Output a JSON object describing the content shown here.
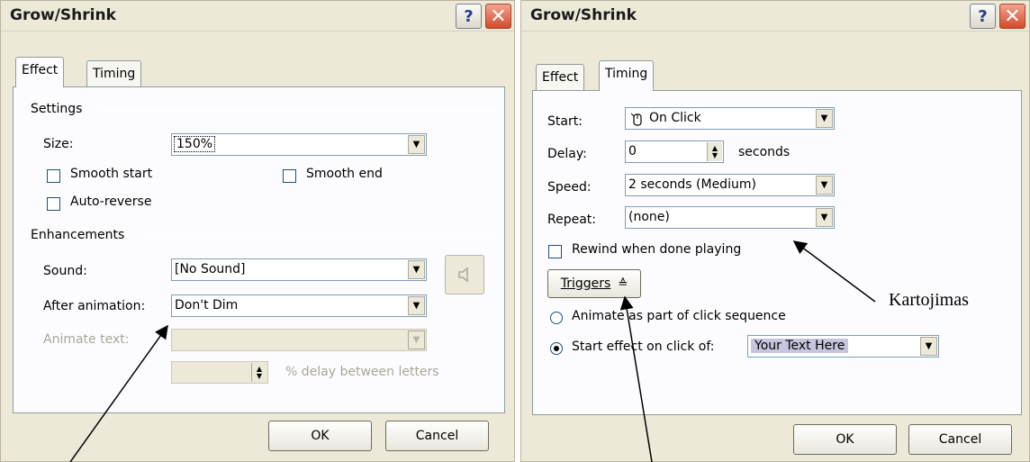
{
  "left_dialog": {
    "title": "Grow/Shrink",
    "help_label": "?",
    "close_label": "✕",
    "tabs": [
      {
        "label": "Effect",
        "active": true
      },
      {
        "label": "Timing",
        "active": false
      }
    ],
    "settings": {
      "group_label": "Settings",
      "size_label": "Size:",
      "size_value": "150%",
      "smooth_start_label": "Smooth start",
      "smooth_end_label": "Smooth end",
      "auto_reverse_label": "Auto-reverse"
    },
    "enhancements": {
      "group_label": "Enhancements",
      "sound_label": "Sound:",
      "sound_value": "[No Sound]",
      "after_animation_label": "After animation:",
      "after_animation_value": "Don't Dim",
      "animate_text_label": "Animate text:",
      "animate_text_value": "",
      "delay_value": "",
      "delay_suffix": "% delay between letters"
    },
    "ok_label": "OK",
    "cancel_label": "Cancel"
  },
  "right_dialog": {
    "title": "Grow/Shrink",
    "help_label": "?",
    "close_label": "✕",
    "tabs": [
      {
        "label": "Effect",
        "active": false
      },
      {
        "label": "Timing",
        "active": true
      }
    ],
    "start_label": "Start:",
    "start_value": "On Click",
    "delay_label": "Delay:",
    "delay_value": "0",
    "delay_unit": "seconds",
    "speed_label": "Speed:",
    "speed_value": "2 seconds (Medium)",
    "repeat_label": "Repeat:",
    "repeat_value": "(none)",
    "rewind_label": "Rewind when done playing",
    "triggers_label": "Triggers",
    "animate_sequence_label": "Animate as part of click sequence",
    "start_on_click_label": "Start effect on click of:",
    "start_on_click_value": "Your Text Here",
    "ok_label": "OK",
    "cancel_label": "Cancel"
  },
  "annotations": {
    "repeat_note": "Kartojimas"
  },
  "icons": {
    "dropdown": "▼",
    "spin_up": "▲",
    "spin_down": "▼",
    "triggers_chevron": "≙",
    "sound": "speaker-icon",
    "mouse": "mouse-click-icon"
  }
}
